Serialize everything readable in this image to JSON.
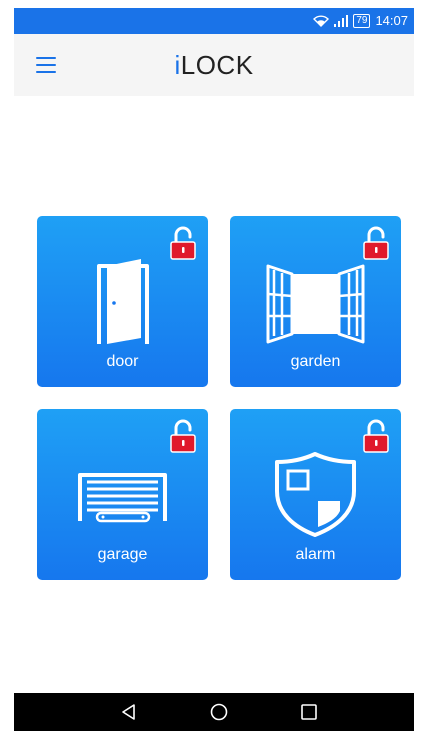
{
  "status_bar": {
    "battery": "79",
    "time": "14:07",
    "icons": [
      "wifi-icon",
      "signal-icon",
      "battery-icon"
    ]
  },
  "app_bar": {
    "title_prefix": "i",
    "title_rest": "LOCK",
    "menu_icon": "hamburger-menu-icon"
  },
  "tiles": [
    {
      "label": "door",
      "icon": "door-icon",
      "lock_state": "unlocked"
    },
    {
      "label": "garden",
      "icon": "garden-window-icon",
      "lock_state": "unlocked"
    },
    {
      "label": "garage",
      "icon": "garage-door-icon",
      "lock_state": "unlocked"
    },
    {
      "label": "alarm",
      "icon": "alarm-shield-icon",
      "lock_state": "unlocked"
    }
  ],
  "nav_bar": {
    "buttons": [
      "back-icon",
      "home-icon",
      "recents-icon"
    ]
  },
  "colors": {
    "accent": "#1a73e8",
    "tile_top": "#1fa0f5",
    "tile_bottom": "#1677ee",
    "lock_red": "#e0192b"
  }
}
